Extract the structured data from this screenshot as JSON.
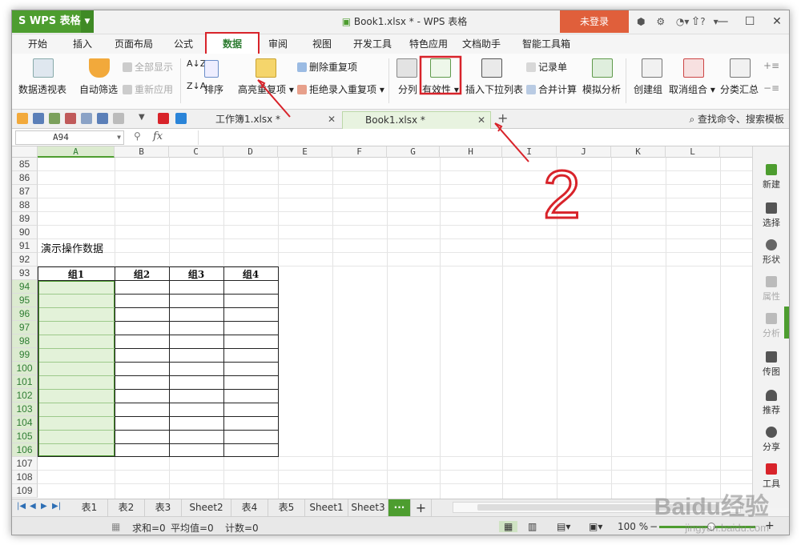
{
  "app": {
    "brand": "WPS 表格",
    "window_title": "Book1.xlsx * - WPS 表格",
    "login_label": "未登录",
    "help_label": "?"
  },
  "menu_tabs": [
    "开始",
    "插入",
    "页面布局",
    "公式",
    "数据",
    "审阅",
    "视图",
    "开发工具",
    "特色应用",
    "文档助手",
    "智能工具箱"
  ],
  "ribbon": {
    "pivot": "数据透视表",
    "autofilter": "自动筛选",
    "show_all": "全部显示",
    "reapply": "重新应用",
    "sort": "排序",
    "highlight_dup": "高亮重复项",
    "remove_dup": "删除重复项",
    "reject_dup": "拒绝录入重复项",
    "split": "分列",
    "validity": "有效性",
    "insert_dropdown": "插入下拉列表",
    "record": "记录单",
    "consolidate": "合并计算",
    "simulate": "模拟分析",
    "create_group": "创建组",
    "ungroup": "取消组合",
    "subtotal": "分类汇总"
  },
  "doc_tabs": [
    {
      "label": "工作簿1.xlsx *"
    },
    {
      "label": "Book1.xlsx *"
    }
  ],
  "search_label": "查找命令、搜索模板",
  "formula_bar": {
    "name_box": "A94",
    "fx": "fx",
    "content": ""
  },
  "columns": [
    "A",
    "B",
    "C",
    "D",
    "E",
    "F",
    "G",
    "H",
    "I",
    "J",
    "K",
    "L"
  ],
  "rows": [
    "85",
    "86",
    "87",
    "88",
    "89",
    "90",
    "91",
    "92",
    "93",
    "94",
    "95",
    "96",
    "97",
    "98",
    "99",
    "100",
    "101",
    "102",
    "103",
    "104",
    "105",
    "106",
    "107",
    "108",
    "109"
  ],
  "cells": {
    "title": "演示操作数据",
    "headers": [
      "组1",
      "组2",
      "组3",
      "组4"
    ]
  },
  "side_panel": [
    "新建",
    "选择",
    "形状",
    "属性",
    "分析",
    "传图",
    "推荐",
    "分享",
    "工具"
  ],
  "sheet_tabs": [
    "表1",
    "表2",
    "表3",
    "Sheet2",
    "表4",
    "表5",
    "Sheet1",
    "Sheet3"
  ],
  "sheet_more": "···",
  "status": {
    "sum": "求和=0",
    "avg": "平均值=0",
    "count": "计数=0",
    "zoom": "100 %"
  },
  "annotation_number": "2",
  "watermark": {
    "brand": "Baidu经验",
    "url": "jingyan.baidu.com"
  },
  "colors": {
    "accent_green": "#4d9d2f",
    "highlight_red": "#d8232a",
    "login_orange": "#e05f3b"
  }
}
